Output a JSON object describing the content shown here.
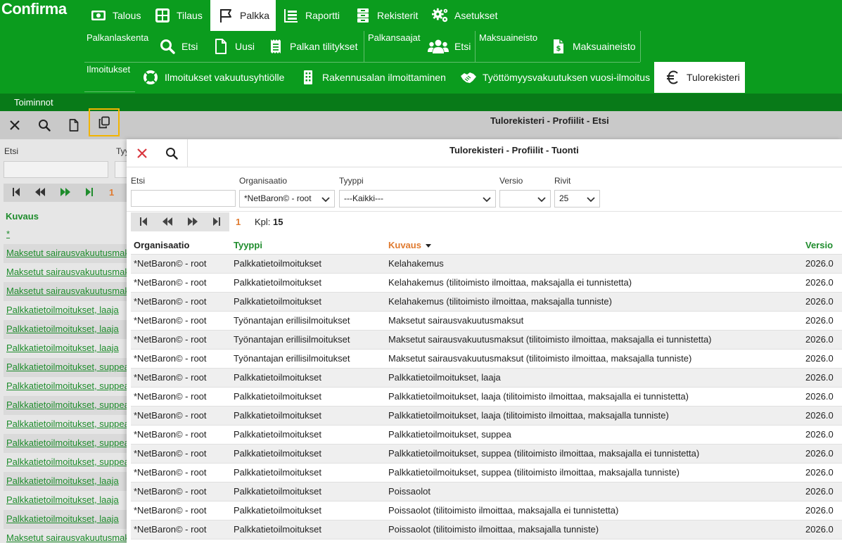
{
  "app": {
    "logo": "Confirma"
  },
  "nav": {
    "main": [
      {
        "label": "Talous"
      },
      {
        "label": "Tilaus"
      },
      {
        "label": "Palkka"
      },
      {
        "label": "Raportti"
      },
      {
        "label": "Rekisterit"
      },
      {
        "label": "Asetukset"
      }
    ],
    "palkanlaskenta": {
      "group": "Palkanlaskenta",
      "items": [
        {
          "label": "Etsi"
        },
        {
          "label": "Uusi"
        },
        {
          "label": "Palkan tilitykset"
        }
      ]
    },
    "palkansaajat": {
      "group": "Palkansaajat",
      "items": [
        {
          "label": "Etsi"
        }
      ]
    },
    "maksuaineisto": {
      "group": "Maksuaineisto",
      "items": [
        {
          "label": "Maksuaineisto"
        }
      ]
    },
    "ilmoitukset": {
      "group": "Ilmoitukset",
      "items": [
        {
          "label": "Ilmoitukset vakuutusyhtiölle"
        },
        {
          "label": "Rakennusalan ilmoittaminen"
        },
        {
          "label": "Työttömyysvakuutuksen vuosi-ilmoitus"
        },
        {
          "label": "Tulorekisteri"
        }
      ]
    }
  },
  "toiminnot": "Toiminnot",
  "background_window": {
    "title": "Tulorekisteri - Profiilit - Etsi",
    "search_label": "Etsi",
    "type_label": "Tyy",
    "page": "1",
    "column": "Kuvaus",
    "rows": [
      "*",
      "Maksetut sairausvakuutusmaksut",
      "Maksetut sairausvakuutusmaksut",
      "Maksetut sairausvakuutusmaksut",
      "Palkkatietoilmoitukset, laaja",
      "Palkkatietoilmoitukset, laaja",
      "Palkkatietoilmoitukset, laaja",
      "Palkkatietoilmoitukset, suppea",
      "Palkkatietoilmoitukset, suppea",
      "Palkkatietoilmoitukset, suppea",
      "Palkkatietoilmoitukset, suppea",
      "Palkkatietoilmoitukset, suppea",
      "Palkkatietoilmoitukset, suppea",
      "Palkkatietoilmoitukset, laaja",
      "Palkkatietoilmoitukset, laaja",
      "Palkkatietoilmoitukset, laaja",
      "Maksetut sairausvakuutusmaksut"
    ]
  },
  "modal": {
    "title": "Tulorekisteri - Profiilit - Tuonti",
    "filters": {
      "search_label": "Etsi",
      "search_value": "",
      "org_label": "Organisaatio",
      "org_value": "*NetBaron© - root",
      "type_label": "Tyyppi",
      "type_value": "---Kaikki---",
      "version_label": "Versio",
      "version_value": "",
      "rows_label": "Rivit",
      "rows_value": "25"
    },
    "pager": {
      "page": "1",
      "count_label": "Kpl:",
      "count": "15"
    },
    "columns": {
      "org": "Organisaatio",
      "type": "Tyyppi",
      "desc": "Kuvaus",
      "version": "Versio"
    },
    "rows": [
      {
        "org": "*NetBaron© - root",
        "type": "Palkkatietoilmoitukset",
        "desc": "Kelahakemus",
        "version": "2026.0"
      },
      {
        "org": "*NetBaron© - root",
        "type": "Palkkatietoilmoitukset",
        "desc": "Kelahakemus (tilitoimisto ilmoittaa, maksajalla ei tunnistetta)",
        "version": "2026.0"
      },
      {
        "org": "*NetBaron© - root",
        "type": "Palkkatietoilmoitukset",
        "desc": "Kelahakemus (tilitoimisto ilmoittaa, maksajalla tunniste)",
        "version": "2026.0"
      },
      {
        "org": "*NetBaron© - root",
        "type": "Työnantajan erillisilmoitukset",
        "desc": "Maksetut sairausvakuutusmaksut",
        "version": "2026.0"
      },
      {
        "org": "*NetBaron© - root",
        "type": "Työnantajan erillisilmoitukset",
        "desc": "Maksetut sairausvakuutusmaksut (tilitoimisto ilmoittaa, maksajalla ei tunnistetta)",
        "version": "2026.0"
      },
      {
        "org": "*NetBaron© - root",
        "type": "Työnantajan erillisilmoitukset",
        "desc": "Maksetut sairausvakuutusmaksut (tilitoimisto ilmoittaa, maksajalla tunniste)",
        "version": "2026.0"
      },
      {
        "org": "*NetBaron© - root",
        "type": "Palkkatietoilmoitukset",
        "desc": "Palkkatietoilmoitukset, laaja",
        "version": "2026.0"
      },
      {
        "org": "*NetBaron© - root",
        "type": "Palkkatietoilmoitukset",
        "desc": "Palkkatietoilmoitukset, laaja (tilitoimisto ilmoittaa, maksajalla ei tunnistetta)",
        "version": "2026.0"
      },
      {
        "org": "*NetBaron© - root",
        "type": "Palkkatietoilmoitukset",
        "desc": "Palkkatietoilmoitukset, laaja (tilitoimisto ilmoittaa, maksajalla tunniste)",
        "version": "2026.0"
      },
      {
        "org": "*NetBaron© - root",
        "type": "Palkkatietoilmoitukset",
        "desc": "Palkkatietoilmoitukset, suppea",
        "version": "2026.0"
      },
      {
        "org": "*NetBaron© - root",
        "type": "Palkkatietoilmoitukset",
        "desc": "Palkkatietoilmoitukset, suppea (tilitoimisto ilmoittaa, maksajalla ei tunnistetta)",
        "version": "2026.0"
      },
      {
        "org": "*NetBaron© - root",
        "type": "Palkkatietoilmoitukset",
        "desc": "Palkkatietoilmoitukset, suppea (tilitoimisto ilmoittaa, maksajalla tunniste)",
        "version": "2026.0"
      },
      {
        "org": "*NetBaron© - root",
        "type": "Palkkatietoilmoitukset",
        "desc": "Poissaolot",
        "version": "2026.0"
      },
      {
        "org": "*NetBaron© - root",
        "type": "Palkkatietoilmoitukset",
        "desc": "Poissaolot (tilitoimisto ilmoittaa, maksajalla ei tunnistetta)",
        "version": "2026.0"
      },
      {
        "org": "*NetBaron© - root",
        "type": "Palkkatietoilmoitukset",
        "desc": "Poissaolot (tilitoimisto ilmoittaa, maksajalla tunniste)",
        "version": "2026.0"
      }
    ]
  },
  "colors": {
    "brand_green": "#0b9c1e",
    "dark_green": "#087a18",
    "link_green": "#1e8c2c",
    "accent_orange": "#e07a2f",
    "focus_yellow": "#f2b400",
    "close_red": "#d9363e"
  }
}
